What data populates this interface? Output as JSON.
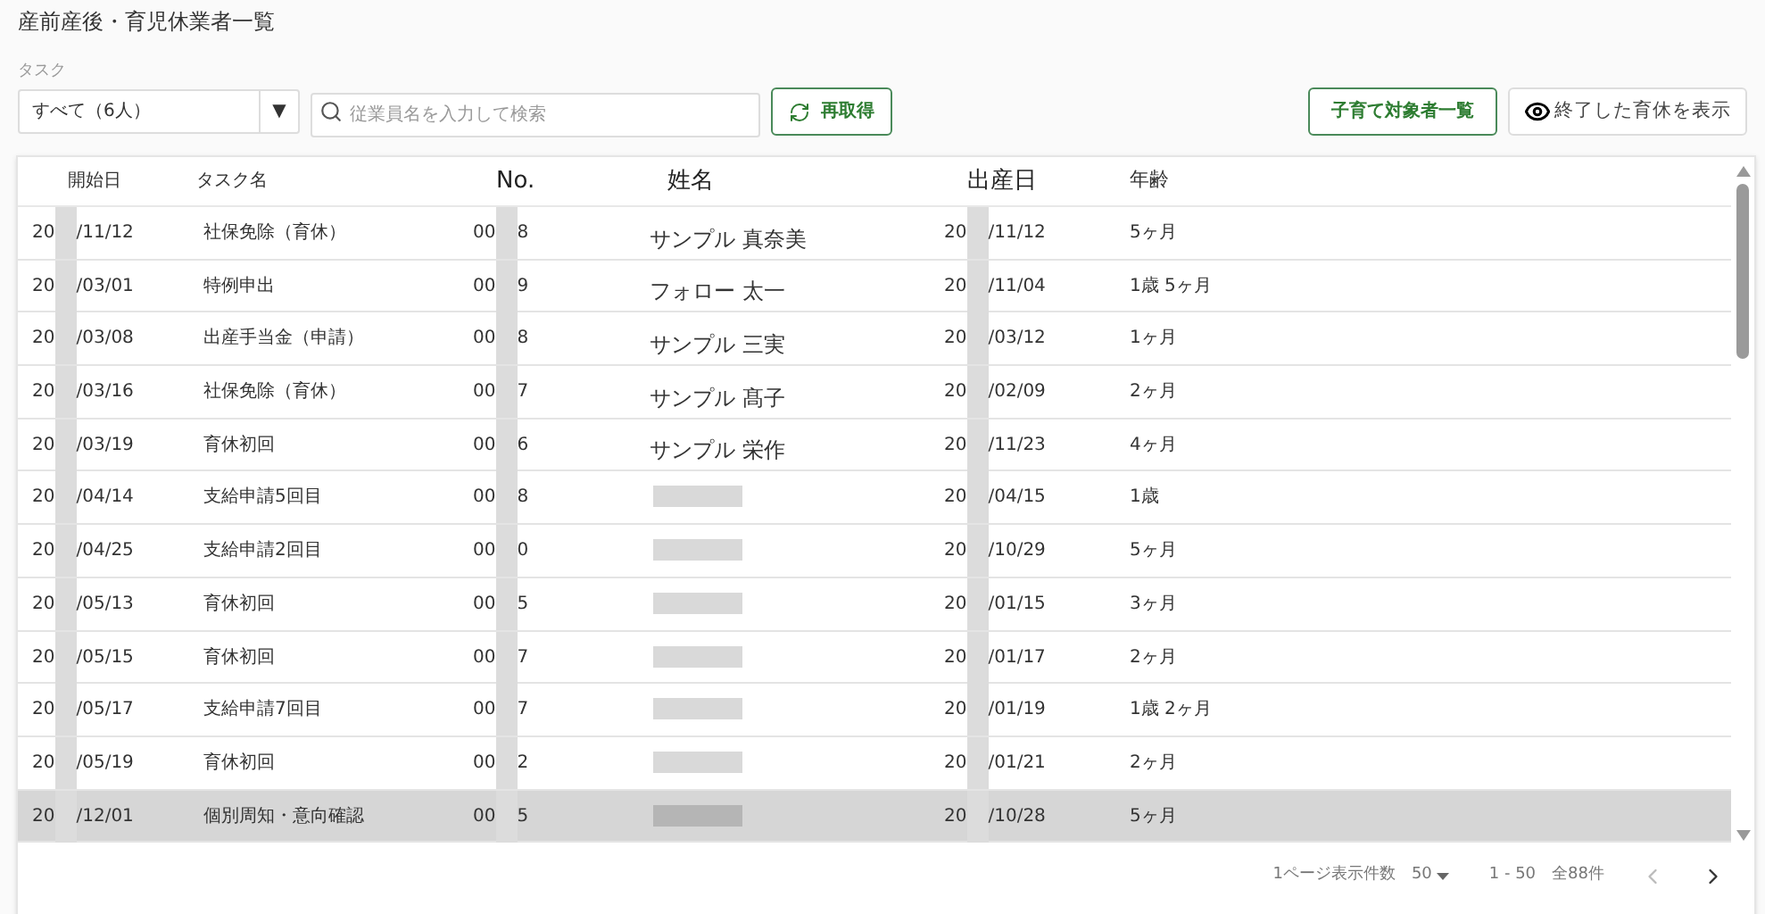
{
  "page_title": "産前産後・育児休業者一覧",
  "task_filter": {
    "label": "タスク",
    "value": "すべて（6人）",
    "arrow": "▼"
  },
  "search": {
    "placeholder": "従業員名を入力して検索"
  },
  "refresh_button": "再取得",
  "childcare_button": "子育て対象者一覧",
  "show_ended_button": "終了した育休を表示",
  "table": {
    "columns": [
      "開始日",
      "タスク名",
      "No.",
      "姓名",
      "出産日",
      "年齢"
    ],
    "rows": [
      {
        "start": [
          "20",
          "/11/12"
        ],
        "task": "社保免除（育休）",
        "no": [
          "00",
          "8"
        ],
        "name": "サンプル 真奈美",
        "birth": [
          "20",
          "/11/12"
        ],
        "age": "5ヶ月",
        "selected": false
      },
      {
        "start": [
          "20",
          "/03/01"
        ],
        "task": "特例申出",
        "no": [
          "00",
          "9"
        ],
        "name": "フォロー 太一",
        "birth": [
          "20",
          "/11/04"
        ],
        "age": "1歳 5ヶ月",
        "selected": false
      },
      {
        "start": [
          "20",
          "/03/08"
        ],
        "task": "出産手当金（申請）",
        "no": [
          "00",
          "8"
        ],
        "name": "サンプル 三実",
        "birth": [
          "20",
          "/03/12"
        ],
        "age": "1ヶ月",
        "selected": false
      },
      {
        "start": [
          "20",
          "/03/16"
        ],
        "task": "社保免除（育休）",
        "no": [
          "00",
          "7"
        ],
        "name": "サンプル 髙子",
        "birth": [
          "20",
          "/02/09"
        ],
        "age": "2ヶ月",
        "selected": false
      },
      {
        "start": [
          "20",
          "/03/19"
        ],
        "task": "育休初回",
        "no": [
          "00",
          "6"
        ],
        "name": "サンプル 栄作",
        "birth": [
          "20",
          "/11/23"
        ],
        "age": "4ヶ月",
        "selected": false
      },
      {
        "start": [
          "20",
          "/04/14"
        ],
        "task": "支給申請5回目",
        "no": [
          "00",
          "8"
        ],
        "birth": [
          "20",
          "/04/15"
        ],
        "age": "1歳",
        "selected": false
      },
      {
        "start": [
          "20",
          "/04/25"
        ],
        "task": "支給申請2回目",
        "no": [
          "00",
          "0"
        ],
        "birth": [
          "20",
          "/10/29"
        ],
        "age": "5ヶ月",
        "selected": false
      },
      {
        "start": [
          "20",
          "/05/13"
        ],
        "task": "育休初回",
        "no": [
          "00",
          "5"
        ],
        "birth": [
          "20",
          "/01/15"
        ],
        "age": "3ヶ月",
        "selected": false
      },
      {
        "start": [
          "20",
          "/05/15"
        ],
        "task": "育休初回",
        "no": [
          "00",
          "7"
        ],
        "birth": [
          "20",
          "/01/17"
        ],
        "age": "2ヶ月",
        "selected": false
      },
      {
        "start": [
          "20",
          "/05/17"
        ],
        "task": "支給申請7回目",
        "no": [
          "00",
          "7"
        ],
        "birth": [
          "20",
          "/01/19"
        ],
        "age": "1歳 2ヶ月",
        "selected": false
      },
      {
        "start": [
          "20",
          "/05/19"
        ],
        "task": "育休初回",
        "no": [
          "00",
          "2"
        ],
        "birth": [
          "20",
          "/01/21"
        ],
        "age": "2ヶ月",
        "selected": false
      },
      {
        "start": [
          "20",
          "/12/01"
        ],
        "task": "個別周知・意向確認",
        "no": [
          "00",
          "5"
        ],
        "birth": [
          "20",
          "/10/28"
        ],
        "age": "5ヶ月",
        "selected": true
      }
    ]
  },
  "pagination": {
    "per_page_label": "1ページ表示件数",
    "per_page": "50",
    "range": "1 - 50",
    "total": "全88件"
  }
}
